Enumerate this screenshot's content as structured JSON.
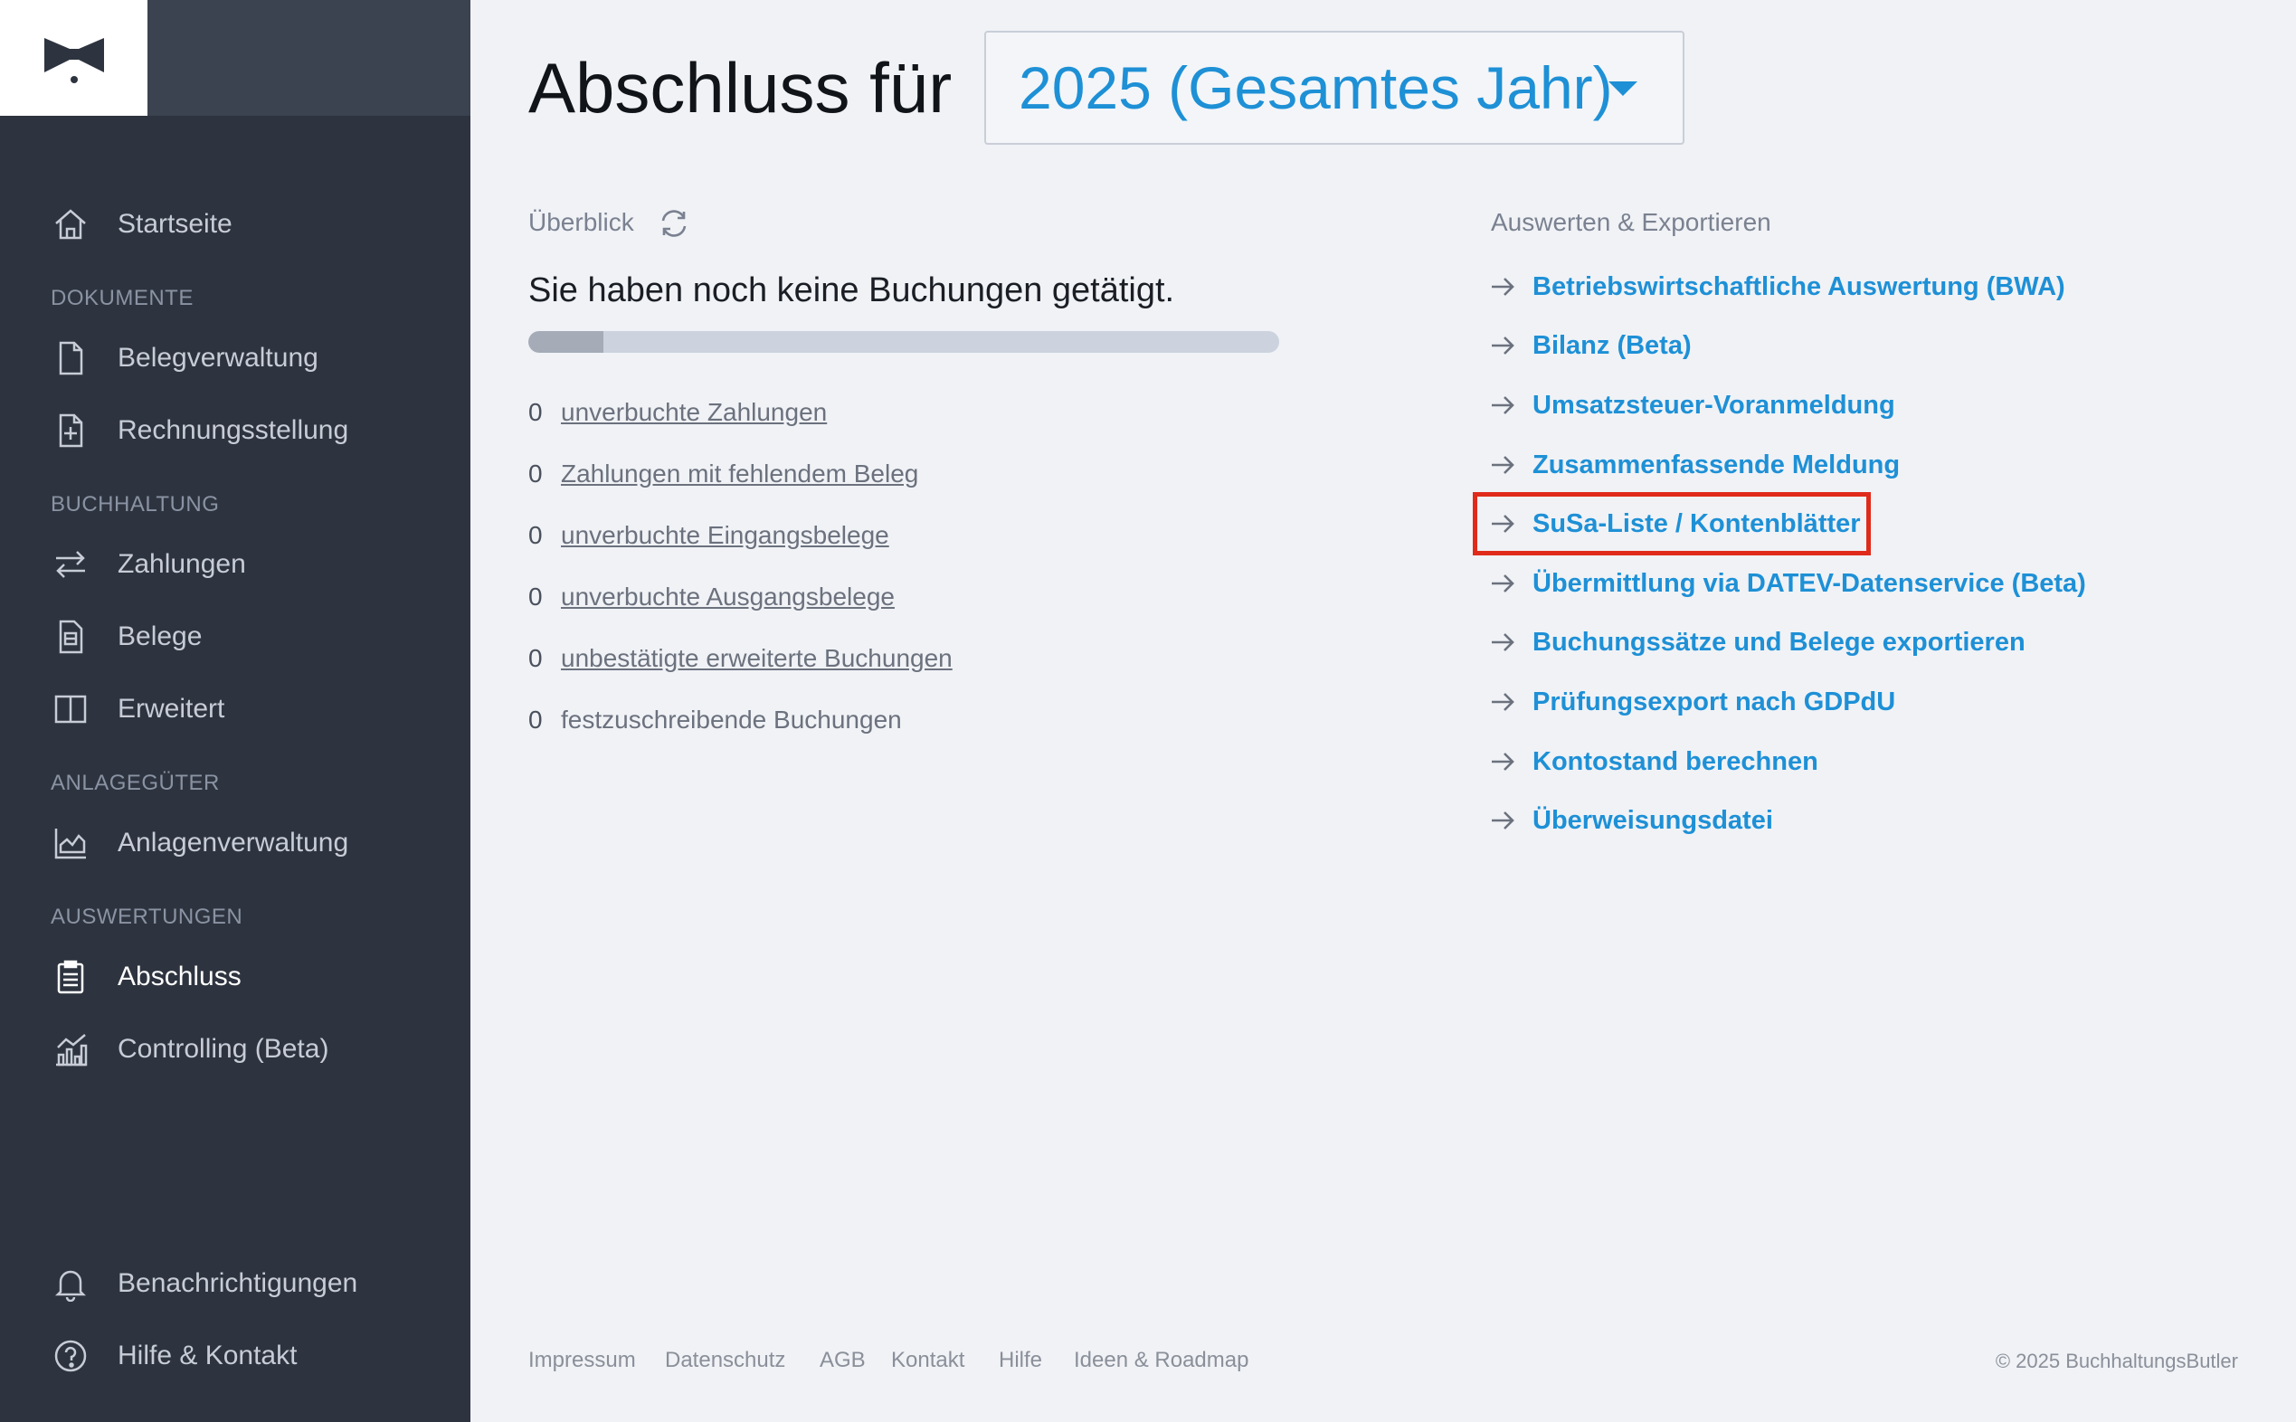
{
  "app": {
    "copyright": "© 2025 BuchhaltungsButler"
  },
  "colors": {
    "accent": "#1e90d6",
    "highlight": "#e02b1b",
    "sidebar_bg": "#2e343f",
    "progress_fill": "#a5acb8"
  },
  "sidebar": {
    "items": [
      {
        "label": "Startseite",
        "icon": "home-icon"
      },
      {
        "label": "Belegverwaltung",
        "icon": "document-icon"
      },
      {
        "label": "Rechnungsstellung",
        "icon": "document-plus-icon"
      },
      {
        "label": "Zahlungen",
        "icon": "transfer-icon"
      },
      {
        "label": "Belege",
        "icon": "receipt-icon"
      },
      {
        "label": "Erweitert",
        "icon": "columns-icon"
      },
      {
        "label": "Anlagenverwaltung",
        "icon": "factory-chart-icon"
      },
      {
        "label": "Abschluss",
        "icon": "clipboard-icon",
        "active": true
      },
      {
        "label": "Controlling (Beta)",
        "icon": "bar-chart-icon"
      },
      {
        "label": "Benachrichtigungen",
        "icon": "bell-icon"
      },
      {
        "label": "Hilfe & Kontakt",
        "icon": "help-icon"
      }
    ],
    "sections": [
      "DOKUMENTE",
      "BUCHHALTUNG",
      "ANLAGEGÜTER",
      "AUSWERTUNGEN"
    ]
  },
  "header": {
    "title": "Abschluss für",
    "year_selected": "2025 (Gesamtes Jahr)"
  },
  "overview": {
    "label": "Überblick",
    "message": "Sie haben noch keine Buchungen getätigt.",
    "progress_fraction": 0.1,
    "stats": [
      {
        "count": "0",
        "label": "unverbuchte Zahlungen"
      },
      {
        "count": "0",
        "label": "Zahlungen mit fehlendem Beleg"
      },
      {
        "count": "0",
        "label": "unverbuchte Eingangsbelege"
      },
      {
        "count": "0",
        "label": "unverbuchte Ausgangsbelege"
      },
      {
        "count": "0",
        "label": "unbestätigte erweiterte Buchungen"
      },
      {
        "count": "0",
        "label": "festzuschreibende Buchungen"
      }
    ]
  },
  "exports": {
    "label": "Auswerten & Exportieren",
    "items": [
      "Betriebswirtschaftliche Auswertung (BWA)",
      "Bilanz (Beta)",
      "Umsatzsteuer-Voranmeldung",
      "Zusammenfassende Meldung",
      "SuSa-Liste / Kontenblätter",
      "Übermittlung via DATEV-Datenservice (Beta)",
      "Buchungssätze und Belege exportieren",
      "Prüfungsexport nach GDPdU",
      "Kontostand berechnen",
      "Überweisungsdatei"
    ],
    "highlighted_item": "SuSa-Liste / Kontenblätter"
  },
  "footer": {
    "links": [
      "Impressum",
      "Datenschutz",
      "AGB",
      "Kontakt",
      "Hilfe",
      "Ideen & Roadmap"
    ]
  }
}
